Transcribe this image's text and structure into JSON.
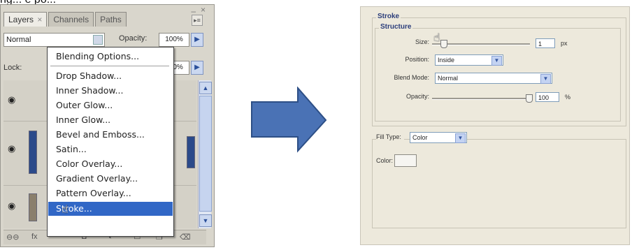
{
  "caption": "ng...   e   po...",
  "ps_panel": {
    "tabs": [
      {
        "label": "Layers",
        "close": "×",
        "active": true
      },
      {
        "label": "Channels",
        "close": "",
        "active": false
      },
      {
        "label": "Paths",
        "close": "",
        "active": false
      }
    ],
    "blend_mode": "Normal",
    "opacity_label": "Opacity:",
    "opacity_value": "100%",
    "lock_label": "Lock:",
    "fill_value": "100%",
    "panel_menu_glyph": "▸≡",
    "footer_icons": [
      "link-icon",
      "fx-icon",
      "mask-icon",
      "adjustment-icon",
      "folder-icon",
      "new-layer-icon",
      "trash-icon"
    ]
  },
  "context_menu": {
    "items": [
      {
        "label": "Blending Options...",
        "selected": false,
        "sep_after": true
      },
      {
        "label": "Drop Shadow...",
        "selected": false,
        "sep_after": false
      },
      {
        "label": "Inner Shadow...",
        "selected": false,
        "sep_after": false
      },
      {
        "label": "Outer Glow...",
        "selected": false,
        "sep_after": false
      },
      {
        "label": "Inner Glow...",
        "selected": false,
        "sep_after": false
      },
      {
        "label": "Bevel and Emboss...",
        "selected": false,
        "sep_after": false
      },
      {
        "label": "Satin...",
        "selected": false,
        "sep_after": false
      },
      {
        "label": "Color Overlay...",
        "selected": false,
        "sep_after": false
      },
      {
        "label": "Gradient Overlay...",
        "selected": false,
        "sep_after": false
      },
      {
        "label": "Pattern Overlay...",
        "selected": false,
        "sep_after": false
      },
      {
        "label": "Stroke...",
        "selected": true,
        "sep_after": false
      }
    ]
  },
  "stroke_dialog": {
    "title": "Stroke",
    "structure_title": "Structure",
    "size_label": "Size:",
    "size_value": "1",
    "size_unit": "px",
    "position_label": "Position:",
    "position_value": "Inside",
    "blend_label": "Blend Mode:",
    "blend_value": "Normal",
    "opacity_label": "Opacity:",
    "opacity_value": "100",
    "opacity_unit": "%",
    "fill_type_label": "Fill Type:",
    "fill_type_value": "Color",
    "color_label": "Color:"
  },
  "colors": {
    "menu_highlight": "#3167c6",
    "arrow_fill": "#4a72b5",
    "arrow_stroke": "#2d4f86",
    "dialog_bg": "#ede9dc",
    "section_title": "#2b3d7a"
  }
}
